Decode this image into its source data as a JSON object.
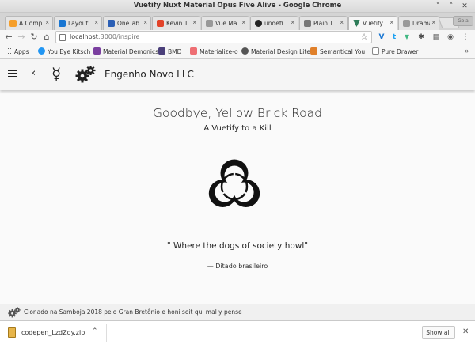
{
  "window": {
    "title": "Vuetify Nuxt Material Opus Five Alive - Google Chrome",
    "minimize_glyph": "˅",
    "maximize_glyph": "˄",
    "close_glyph": "✕"
  },
  "tabs": [
    {
      "label": "A Comp",
      "favicon_color": "#f59e2a",
      "active": false
    },
    {
      "label": "Layout",
      "favicon_color": "#1976d2",
      "active": false
    },
    {
      "label": "OneTab",
      "favicon_color": "#2b5fb5",
      "active": false
    },
    {
      "label": "Kevin T",
      "favicon_color": "#e24329",
      "active": false
    },
    {
      "label": "Vue Ma",
      "favicon_color": "#999999",
      "active": false
    },
    {
      "label": "undefi",
      "favicon_color": "#222222",
      "active": false
    },
    {
      "label": "Plain T",
      "favicon_color": "#777777",
      "active": false
    },
    {
      "label": "Vuetify",
      "favicon_color": "#2e7d59",
      "active": true
    },
    {
      "label": "Drama",
      "favicon_color": "#999999",
      "active": false
    }
  ],
  "tab_close_glyph": "×",
  "user_tab_label": "Gola",
  "toolbar": {
    "back_glyph": "←",
    "forward_glyph": "→",
    "reload_glyph": "↻",
    "home_glyph": "⌂",
    "url_host": "localhost",
    "url_path": ":3000/inspire",
    "star_glyph": "☆"
  },
  "extensions": [
    {
      "name": "vuetify-ext-icon",
      "glyph": "V",
      "color": "#1976d2"
    },
    {
      "name": "twitter-ext-icon",
      "glyph": "t",
      "color": "#1da1f2"
    },
    {
      "name": "vue-devtools-icon",
      "glyph": "▼",
      "color": "#41b883"
    },
    {
      "name": "puzzle-ext-icon",
      "glyph": "✱",
      "color": "#444444"
    },
    {
      "name": "menu-ext-icon",
      "glyph": "▤",
      "color": "#444444"
    },
    {
      "name": "screenshot-ext-icon",
      "glyph": "◉",
      "color": "#555555"
    },
    {
      "name": "chrome-menu-icon",
      "glyph": "⋮",
      "color": "#555555"
    }
  ],
  "bookmarks": [
    {
      "label": "Apps",
      "icon_color": "#666666"
    },
    {
      "label": "You Eye Kitsch",
      "icon_color": "#2196f3"
    },
    {
      "label": "Material Demonics",
      "icon_color": "#7b3fa0"
    },
    {
      "label": "BMD",
      "icon_color": "#4a3f7a"
    },
    {
      "label": "Materialize-o",
      "icon_color": "#ee6e73"
    },
    {
      "label": "Material Design Lite",
      "icon_color": "#555555"
    },
    {
      "label": "Semantical You",
      "icon_color": "#e0802a"
    },
    {
      "label": "Pure Drawer",
      "icon_color": "#888888"
    }
  ],
  "bookmarks_more": "»",
  "appbar": {
    "back_glyph": "‹",
    "mercury_glyph": "☿",
    "title": "Engenho Novo LLC"
  },
  "main": {
    "headline": "Goodbye, Yellow Brick Road",
    "subheading": "A Vuetify to a Kill",
    "emblem": "biohazard-icon",
    "quote": "\" Where the dogs of society howl\"",
    "attribution": "— Ditado brasileiro"
  },
  "footer": {
    "text": "Clonado na Samboja 2018 pelo Gran Bretônio e honi soit qui mal y pense"
  },
  "downloads": {
    "file_name": "codepen_LzdZqy.zip",
    "caret_glyph": "⌃",
    "show_all_label": "Show all",
    "close_glyph": "✕"
  }
}
